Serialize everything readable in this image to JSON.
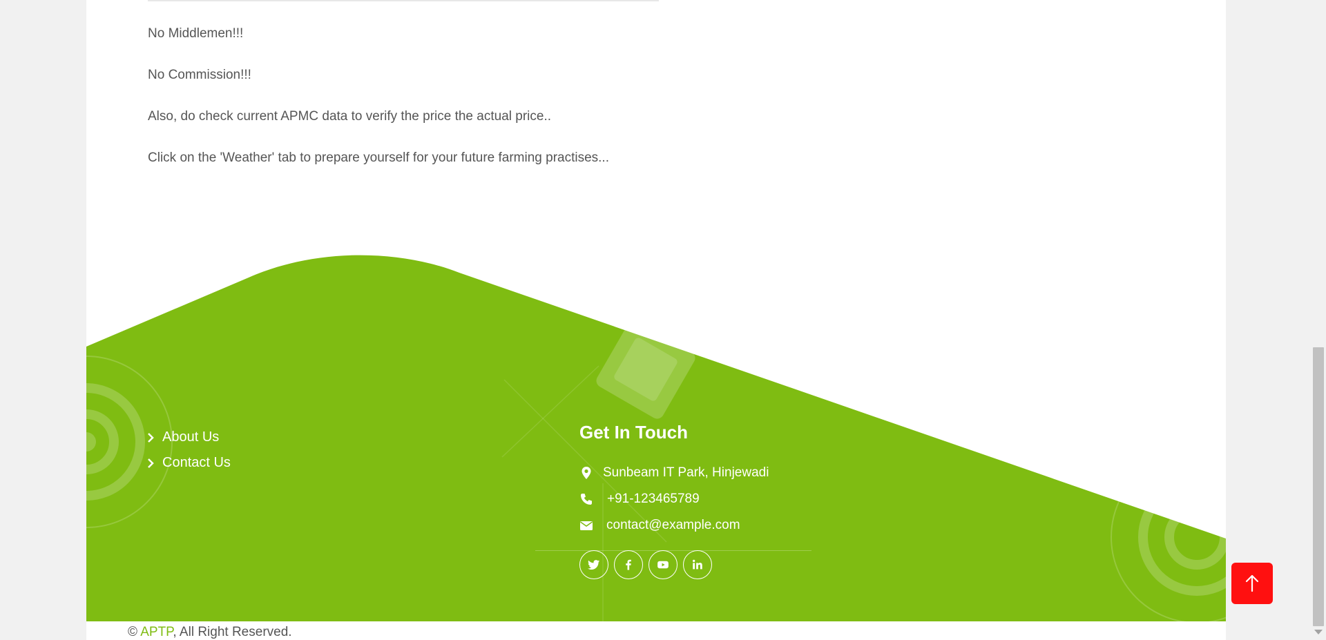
{
  "content": {
    "paragraphs": [
      "No Middlemen!!!",
      "No Commission!!!",
      "Also, do check current APMC data to verify the price the actual price..",
      "Click on the 'Weather' tab to prepare yourself for your future farming practises..."
    ]
  },
  "footer": {
    "quick_links": [
      "About Us",
      "Contact Us"
    ],
    "get_in_touch": {
      "title": "Get In Touch",
      "address": "Sunbeam IT Park, Hinjewadi",
      "phone": "+91-123465789",
      "email": "contact@example.com"
    },
    "social_icons": [
      "twitter-icon",
      "facebook-icon",
      "youtube-icon",
      "linkedin-icon"
    ],
    "copyright": {
      "symbol": "©",
      "brand": "APTP",
      "text": ", All Right Reserved."
    },
    "colors": {
      "footer_green": "#7fbc12",
      "back_to_top": "#ff1010"
    }
  },
  "back_to_top_icon": "arrow-up-icon"
}
